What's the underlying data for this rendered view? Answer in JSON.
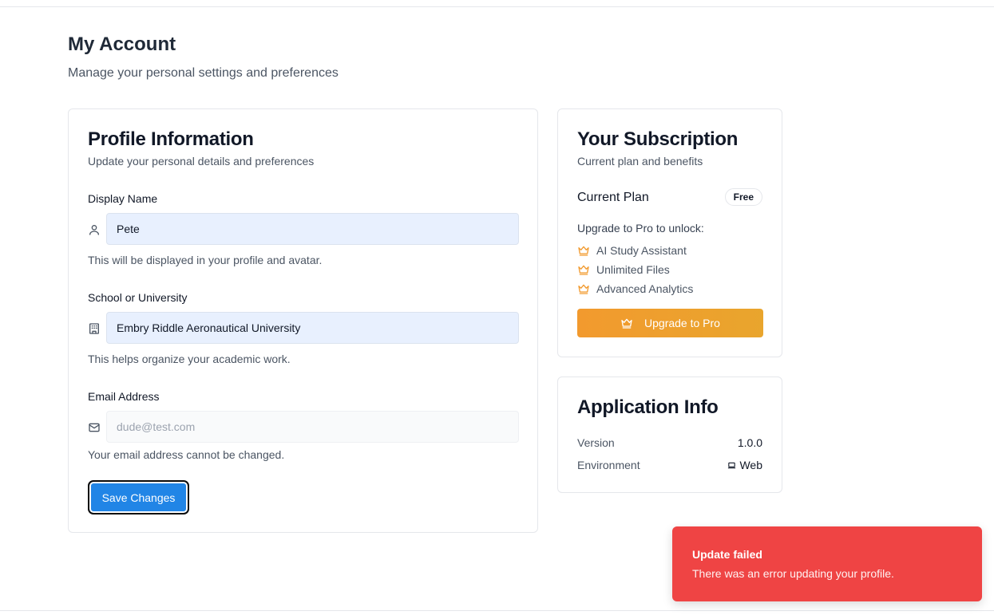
{
  "page": {
    "title": "My Account",
    "subtitle": "Manage your personal settings and preferences"
  },
  "profile": {
    "title": "Profile Information",
    "subtitle": "Update your personal details and preferences",
    "display_name": {
      "label": "Display Name",
      "value": "Pete",
      "help": "This will be displayed in your profile and avatar.",
      "icon": "user-icon"
    },
    "school": {
      "label": "School or University",
      "value": "Embry Riddle Aeronautical University",
      "help": "This helps organize your academic work.",
      "icon": "building-icon"
    },
    "email": {
      "label": "Email Address",
      "placeholder": "dude@test.com",
      "help": "Your email address cannot be changed.",
      "icon": "mail-icon"
    },
    "save_label": "Save Changes"
  },
  "subscription": {
    "title": "Your Subscription",
    "subtitle": "Current plan and benefits",
    "current_plan_label": "Current Plan",
    "plan_badge": "Free",
    "unlock_label": "Upgrade to Pro to unlock:",
    "benefits": [
      "AI Study Assistant",
      "Unlimited Files",
      "Advanced Analytics"
    ],
    "benefit_icon": "crown-icon",
    "upgrade_label": "Upgrade to Pro",
    "accent_color": "#f29a2e"
  },
  "app_info": {
    "title": "Application Info",
    "version_label": "Version",
    "version_value": "1.0.0",
    "environment_label": "Environment",
    "environment_value": "Web",
    "environment_icon": "laptop-icon"
  },
  "toast": {
    "title": "Update failed",
    "description": "There was an error updating your profile.",
    "color": "#ef4444"
  },
  "colors": {
    "primary_button": "#2185e6",
    "input_filled": "#e8f0fe"
  }
}
